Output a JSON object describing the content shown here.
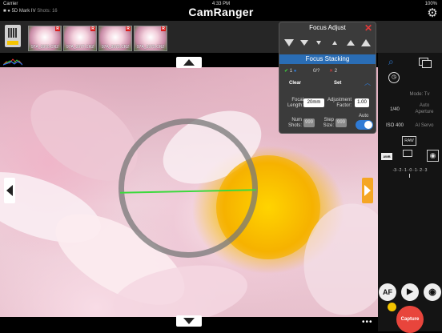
{
  "status": {
    "carrier": "Carrier",
    "time": "4:33 PM",
    "battery": "100%"
  },
  "device": {
    "camera": "5D Mark IV",
    "shots": "Shots: 16"
  },
  "app": {
    "logo": "CamRanger"
  },
  "thumbs": [
    {
      "name": "97A_3976.CR2",
      "badge": "R"
    },
    {
      "name": "97A_3977.CR2",
      "badge": "R"
    },
    {
      "name": "97A_3978.CR2",
      "badge": "R"
    },
    {
      "name": "97A_3979.CR2",
      "badge": "R"
    }
  ],
  "focus": {
    "title": "Focus Adjust",
    "stacking_title": "Focus Stacking",
    "count_ok": "1",
    "progress": "0/?",
    "count_fail": "2",
    "clear": "Clear",
    "set": "Set",
    "focal_length_label": "Focal Length:",
    "focal_length_value": "20mm",
    "adjust_factor_label": "Adjustment Factor:",
    "adjust_factor_value": "1.00",
    "num_shots_label": "Num Shots:",
    "num_shots_value": "999",
    "step_size_label": "Step Size:",
    "step_size_value": "999",
    "auto_label": "Auto",
    "auto_on": true
  },
  "settings": {
    "mode": "Mode: Tv",
    "shutter": "1/40",
    "aperture": "Auto Aperture",
    "iso": "ISO 400",
    "af": "AI Servo",
    "format": "RAW",
    "wb": "AWB",
    "exposure_scale": "-3··2··1··0··1··2··3"
  },
  "buttons": {
    "af": "AF",
    "capture": "Capture",
    "more": "•••"
  },
  "colors": {
    "accent": "#2f7bd6",
    "capture": "#e8453c",
    "arrow": "#f5a623",
    "level": "#3ed93e"
  }
}
